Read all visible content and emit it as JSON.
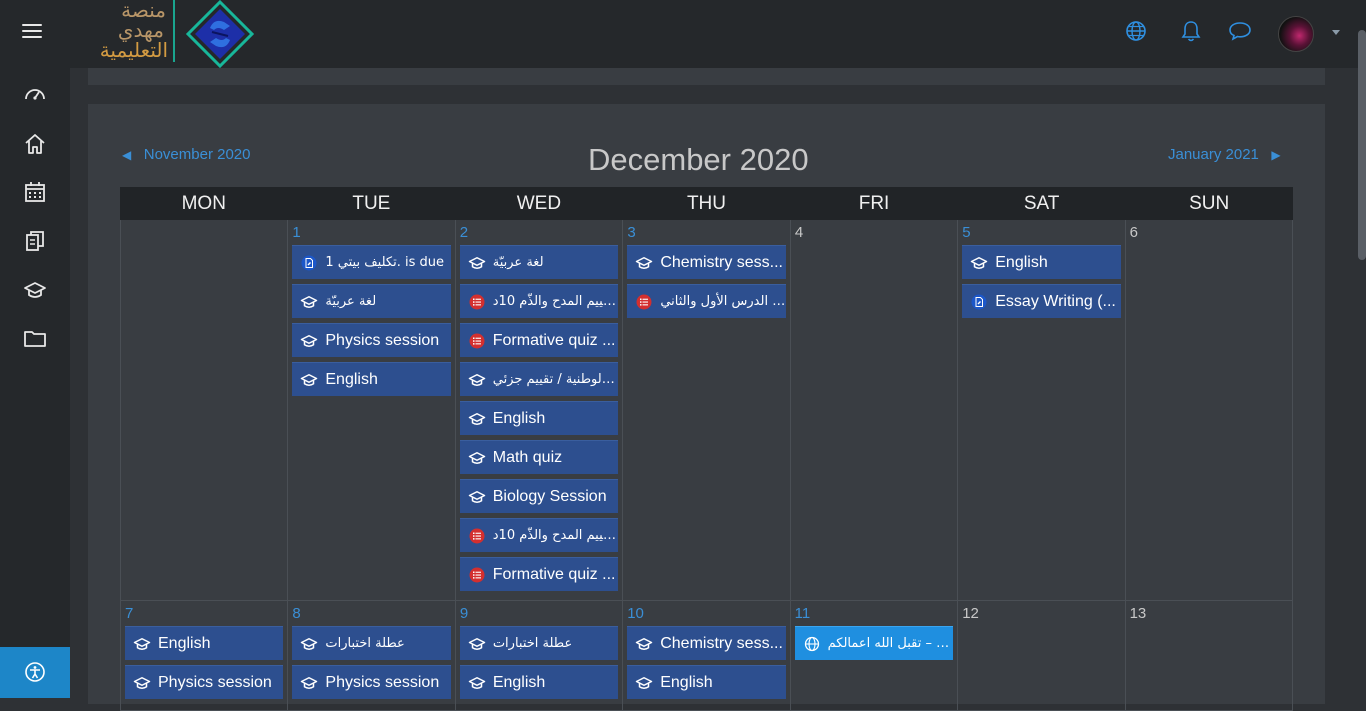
{
  "logo": {
    "line1": "منصة",
    "line2": "مهدي",
    "line3": "التعليمية"
  },
  "calendar": {
    "prev": "November 2020",
    "next": "January 2021",
    "title": "December 2020",
    "days": [
      "MON",
      "TUE",
      "WED",
      "THU",
      "FRI",
      "SAT",
      "SUN"
    ]
  },
  "weeks": [
    [
      {
        "day": "",
        "events": []
      },
      {
        "day": "1",
        "events": [
          {
            "label": "تكليف بيتي 1. is due",
            "icon": "assignment"
          },
          {
            "label": "لغة عربيّة",
            "icon": "course"
          },
          {
            "label": "Physics session",
            "icon": "course"
          },
          {
            "label": "English",
            "icon": "course"
          }
        ]
      },
      {
        "day": "2",
        "events": [
          {
            "label": "لغة عربيّة",
            "icon": "course"
          },
          {
            "label": "تقييم المدح والذّم 10د. ...",
            "icon": "quiz"
          },
          {
            "label": "Formative quiz ...",
            "icon": "quiz"
          },
          {
            "label": "ة الوطنية / تقييم جزئي ...",
            "icon": "course"
          },
          {
            "label": "English",
            "icon": "course"
          },
          {
            "label": "Math quiz",
            "icon": "course"
          },
          {
            "label": "Biology Session",
            "icon": "course"
          },
          {
            "label": "تقييم المدح والذّم 10د. c...",
            "icon": "quiz"
          },
          {
            "label": "Formative quiz ...",
            "icon": "quiz"
          }
        ]
      },
      {
        "day": "3",
        "events": [
          {
            "label": "Chemistry sess...",
            "icon": "course"
          },
          {
            "label": "في الدرس الأول والثاني ...",
            "icon": "quiz"
          }
        ]
      },
      {
        "day": "4",
        "events": []
      },
      {
        "day": "5",
        "events": [
          {
            "label": "English",
            "icon": "course"
          },
          {
            "label": "Essay Writing (...",
            "icon": "assignment"
          }
        ]
      },
      {
        "day": "6",
        "events": []
      }
    ],
    [
      {
        "day": "7",
        "events": [
          {
            "label": "English",
            "icon": "course"
          },
          {
            "label": "Physics session",
            "icon": "course"
          }
        ]
      },
      {
        "day": "8",
        "events": [
          {
            "label": "عطلة اختبارات",
            "icon": "course"
          },
          {
            "label": "Physics session",
            "icon": "course"
          }
        ]
      },
      {
        "day": "9",
        "events": [
          {
            "label": "عطلة اختبارات",
            "icon": "course"
          },
          {
            "label": "English",
            "icon": "course"
          }
        ]
      },
      {
        "day": "10",
        "events": [
          {
            "label": "Chemistry sess...",
            "icon": "course"
          },
          {
            "label": "English",
            "icon": "course"
          }
        ]
      },
      {
        "day": "11",
        "events": [
          {
            "label": "باركة – تقبل الله اعمالكم ...",
            "icon": "site"
          }
        ]
      },
      {
        "day": "12",
        "events": []
      },
      {
        "day": "13",
        "events": []
      }
    ]
  ],
  "colors": {
    "accent": "#3a8fd6",
    "event": "#2d4f8f",
    "site_event": "#1f8fe0",
    "quiz_icon": "#d32f2f"
  }
}
